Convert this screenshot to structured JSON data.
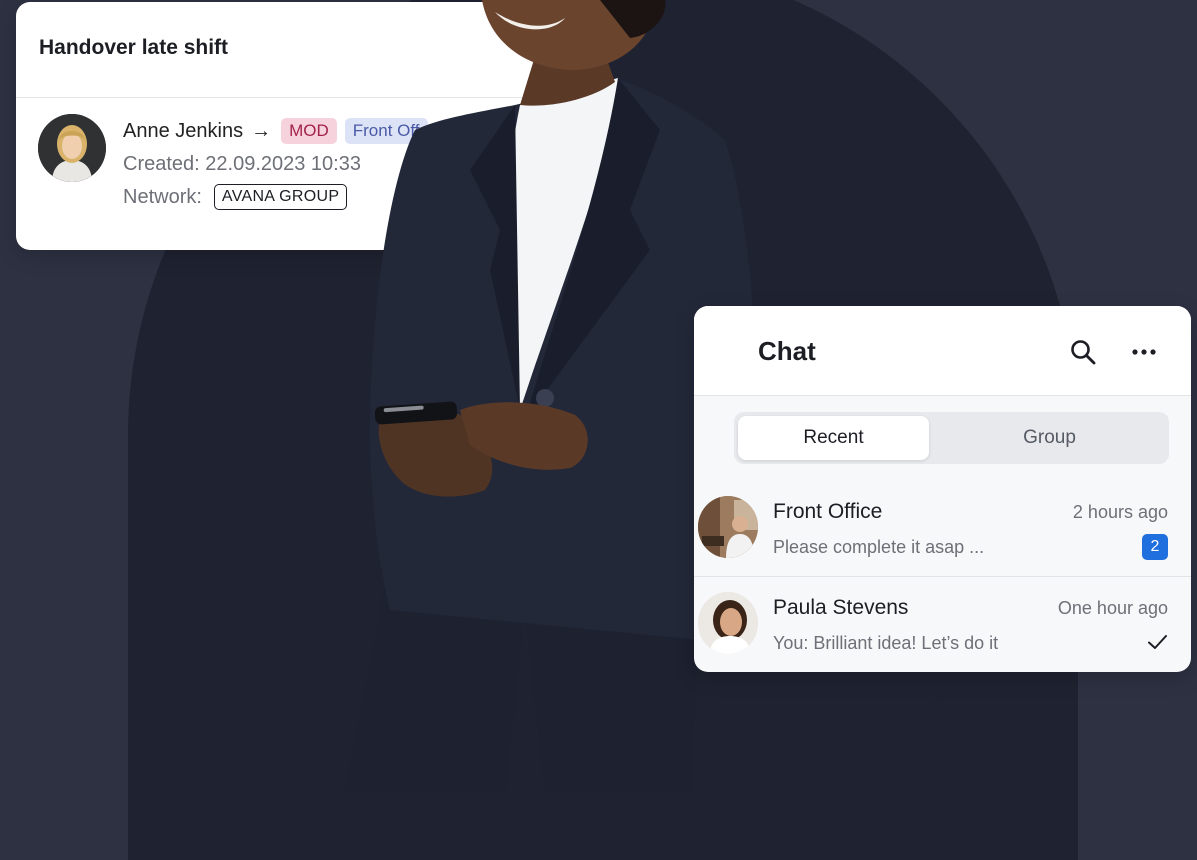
{
  "handover": {
    "title": "Handover late shift",
    "person_name": "Anne Jenkins",
    "arrow": "→",
    "tag_mod": "MOD",
    "tag_front": "Front Off",
    "created": "Created: 22.09.2023 10:33",
    "network_label": "Network:",
    "network_value": "AVANA GROUP"
  },
  "chat": {
    "title": "Chat",
    "tabs": {
      "recent": "Recent",
      "group": "Group"
    },
    "conversations": [
      {
        "name": "Front Office",
        "time": "2 hours ago",
        "preview": "Please complete it asap ...",
        "badge": "2"
      },
      {
        "name": "Paula Stevens",
        "time": "One hour ago",
        "preview": "You: Brilliant idea! Let’s do it"
      }
    ]
  },
  "colors": {
    "background": "#2d3142",
    "card": "#ffffff",
    "badge_blue": "#1f6fde",
    "tag_mod_bg": "#f6d3dc",
    "tag_front_bg": "#dde3f7"
  },
  "icons": [
    "search-icon",
    "more-icon",
    "check-icon",
    "arrow-right-icon"
  ]
}
